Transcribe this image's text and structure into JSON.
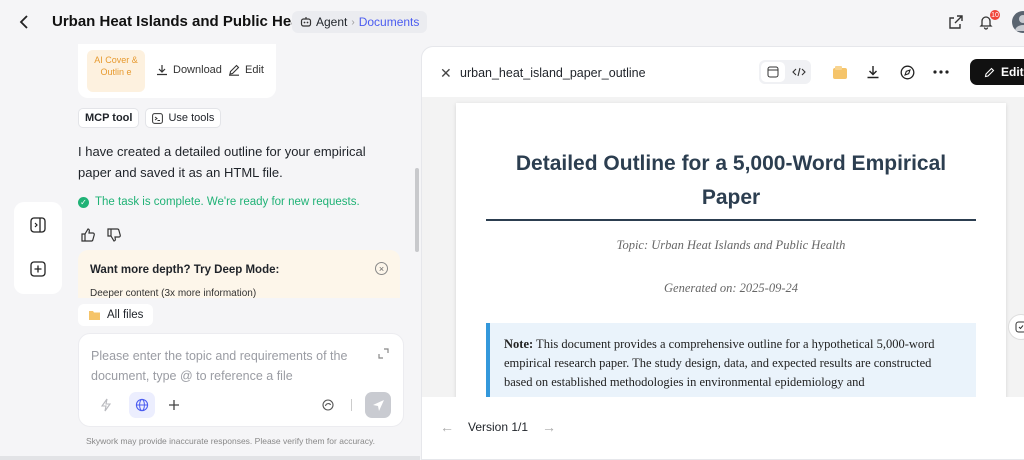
{
  "header": {
    "title": "Urban Heat Islands and Public Health",
    "breadcrumb": {
      "agent": "Agent",
      "documents": "Documents"
    },
    "notifications_count": "10"
  },
  "file_card": {
    "thumb_label": "AI Cover & Outlin e",
    "download_label": "Download",
    "edit_label": "Edit"
  },
  "tools": {
    "mcp_label": "MCP tool",
    "use_tools_label": "Use tools"
  },
  "message": {
    "text": "I have created a detailed outline for your empirical paper and saved it as an HTML file.",
    "status": "The task is complete. We're ready for new requests."
  },
  "deep_mode": {
    "title": "Want more depth? Try Deep Mode:",
    "subtitle": "Deeper content (3x more information)"
  },
  "all_files_label": "All files",
  "input": {
    "placeholder": "Please enter the topic and requirements of the document, type @ to reference a file"
  },
  "disclaimer": "Skywork may provide inaccurate responses. Please verify them for accuracy.",
  "panel": {
    "filename": "urban_heat_island_paper_outline",
    "edit_label": "Edit",
    "version_label": "Version 1/1"
  },
  "document": {
    "heading": "Detailed Outline for a 5,000-Word Empirical Paper",
    "topic": "Topic: Urban Heat Islands and Public Health",
    "generated": "Generated on: 2025-09-24",
    "note_label": "Note:",
    "note_text": " This document provides a comprehensive outline for a hypothetical 5,000-word empirical research paper. The study design, data, and expected results are constructed based on established methodologies in environmental epidemiology and"
  }
}
